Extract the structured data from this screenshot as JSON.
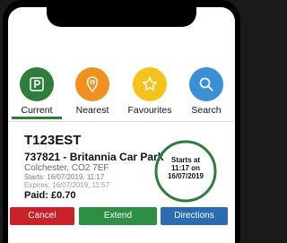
{
  "tabs": [
    {
      "label": "Current",
      "icon": "parking-icon",
      "color": "#2e7d3a"
    },
    {
      "label": "Nearest",
      "icon": "map-pin-icon",
      "color": "#f0901e"
    },
    {
      "label": "Favourites",
      "icon": "star-icon",
      "color": "#f3c21b"
    },
    {
      "label": "Search",
      "icon": "search-icon",
      "color": "#3b8fd6"
    }
  ],
  "active_tab": "Current",
  "session": {
    "plate": "T123EST",
    "location_name": "737821 - Britannia Car Park",
    "address": "Colchester, CO2 7EF",
    "starts_line": "Starts: 16/07/2019, 11:17",
    "expires_line": "Expires: 16/07/2019, 11:57",
    "paid": "Paid: £0.70",
    "ring": {
      "line1": "Starts at",
      "line2": "11:17 on",
      "line3": "16/07/2019",
      "color": "#2e7d3a"
    }
  },
  "buttons": {
    "cancel": "Cancel",
    "extend": "Extend",
    "directions": "Directions"
  },
  "colors": {
    "cancel": "#cc2128",
    "extend": "#2c8f43",
    "directions": "#2a6bb3"
  }
}
